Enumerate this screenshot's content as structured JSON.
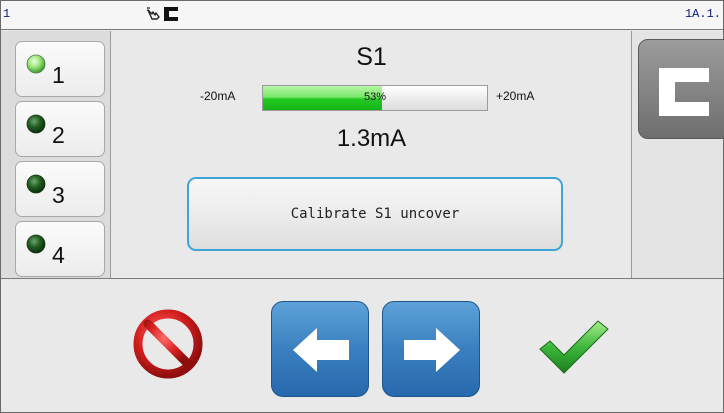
{
  "statusbar": {
    "left_text": "1",
    "right_text": "1A.1.",
    "icons": [
      "hand-touch-icon",
      "c-block-icon"
    ]
  },
  "channels": [
    {
      "label": "1",
      "led": "light-green",
      "selected": true
    },
    {
      "label": "2",
      "led": "dark-green",
      "selected": false
    },
    {
      "label": "3",
      "led": "dark-green",
      "selected": false
    },
    {
      "label": "4",
      "led": "dark-green",
      "selected": false
    }
  ],
  "sensor": {
    "title": "S1",
    "range_min": "-20mA",
    "range_max": "+20mA",
    "level_percent": 53,
    "level_text": "53%",
    "reading": "1.3mA"
  },
  "actions": {
    "calibrate_label": "Calibrate S1 uncover",
    "mode_icon": "c-block-icon",
    "cancel_icon": "no-entry-icon",
    "back_icon": "arrow-left-icon",
    "forward_icon": "arrow-right-icon",
    "confirm_icon": "checkmark-icon"
  },
  "colors": {
    "accent_blue": "#3a80c0",
    "bar_green": "#22c822",
    "cancel_red": "#d41f1f",
    "confirm_green": "#3cb83c",
    "status_text": "#0d1d7a"
  }
}
